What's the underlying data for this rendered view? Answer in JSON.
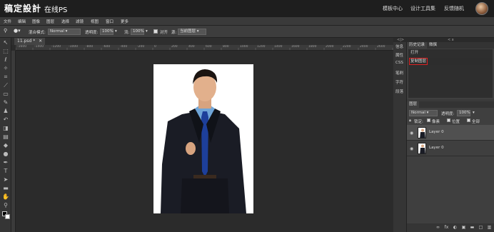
{
  "app": {
    "brand": "稿定設計",
    "subtitle": "在线PS",
    "links": [
      "模板中心",
      "设计工具集",
      "反馈随机"
    ]
  },
  "menu": [
    "文件",
    "编辑",
    "图像",
    "图层",
    "选择",
    "滤镜",
    "视图",
    "窗口",
    "更多"
  ],
  "options": {
    "blend_label": "混合模式:",
    "blend_value": "Normal",
    "opacity_label": "透明度:",
    "opacity_value": "100%",
    "flow_label": "流:",
    "flow_value": "100%",
    "align_label": "对齐",
    "sample_label": "源:",
    "sample_value": "当前图层"
  },
  "tab": {
    "label": "11.psd *",
    "close": "✕"
  },
  "ruler": [
    "-1600",
    "-1400",
    "-1200",
    "-1000",
    "-800",
    "-600",
    "-400",
    "-200",
    "0",
    "200",
    "400",
    "600",
    "800",
    "1000",
    "1200",
    "1400",
    "1600",
    "1800",
    "2000",
    "2200",
    "2400",
    "2600"
  ],
  "right": {
    "collapse_left": "<|>",
    "collapse_right": "< x",
    "side_buttons": [
      "信息",
      "属性",
      "CSS",
      "笔刷",
      "字符",
      "段落"
    ],
    "history_tabs": [
      "历史记录",
      "微撰"
    ],
    "history_items": [
      "打开",
      "复制图层"
    ],
    "layers_tab": "图层",
    "layers_blend": "Normal",
    "layers_opacity_label": "透明度:",
    "layers_opacity": "100%",
    "lock_label": "锁定:",
    "lock_opts": [
      "像素",
      "位置",
      "全部"
    ],
    "layers": [
      {
        "name": "Layer 0"
      },
      {
        "name": "Layer 0"
      }
    ]
  }
}
